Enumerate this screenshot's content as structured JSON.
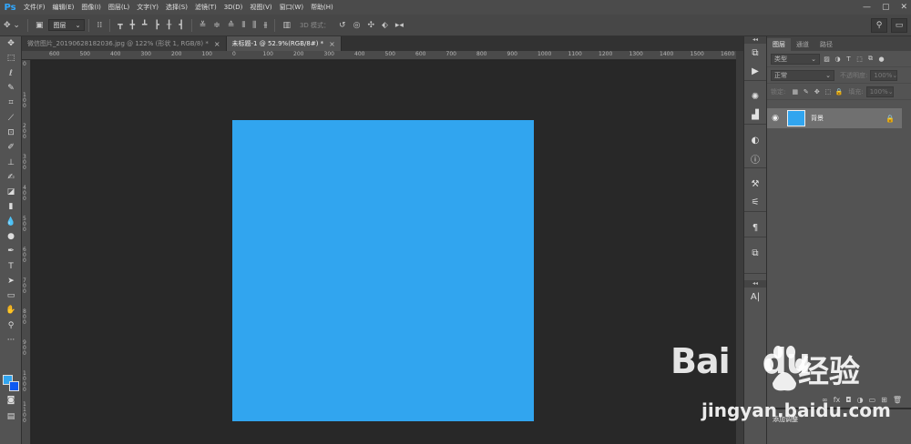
{
  "app": {
    "logo": "Ps"
  },
  "menu": [
    "文件(F)",
    "编辑(E)",
    "图像(I)",
    "图层(L)",
    "文字(Y)",
    "选择(S)",
    "滤镜(T)",
    "3D(D)",
    "视图(V)",
    "窗口(W)",
    "帮助(H)"
  ],
  "window_controls": [
    "—",
    "▢",
    "✕"
  ],
  "options": {
    "layer_select": "图层",
    "mode_3d": "3D 模式："
  },
  "tabs": [
    {
      "label": "微信图片_20190628182036.jpg @ 122% (形状 1, RGB/8) *",
      "close": "×"
    },
    {
      "label": "未标题-1 @ 52.9%(RGB/8#) *",
      "close": "×"
    }
  ],
  "ruler": {
    "top": [
      "600",
      "500",
      "400",
      "300",
      "200",
      "100",
      "0",
      "100",
      "200",
      "300",
      "400",
      "500",
      "600",
      "700",
      "800",
      "900",
      "1000",
      "1100",
      "1200",
      "1300",
      "1400",
      "1500",
      "1600"
    ],
    "left": [
      "0",
      "1 0 0",
      "2 0 0",
      "3 0 0",
      "4 0 0",
      "5 0 0",
      "6 0 0",
      "7 0 0",
      "8 0 0",
      "9 0 0",
      "1 0 0 0",
      "1 1 0 0"
    ]
  },
  "colors": {
    "foreground": "#31a5ef",
    "background": "#0d58f0",
    "canvas": "#31a5ef"
  },
  "layers_panel": {
    "tabs": [
      "图层",
      "通道",
      "路径"
    ],
    "filter_label": "类型",
    "blend_mode": "正常",
    "opacity_label": "不透明度:",
    "opacity_value": "100%",
    "lock_label": "锁定:",
    "fill_label": "填充:",
    "fill_value": "100%",
    "layers": [
      {
        "name": "背景"
      }
    ],
    "adjust_label": "添加调整"
  },
  "watermark": {
    "logo": "Bai",
    "logo2": "du",
    "cn": "经验",
    "url": "jingyan.baidu.com"
  }
}
